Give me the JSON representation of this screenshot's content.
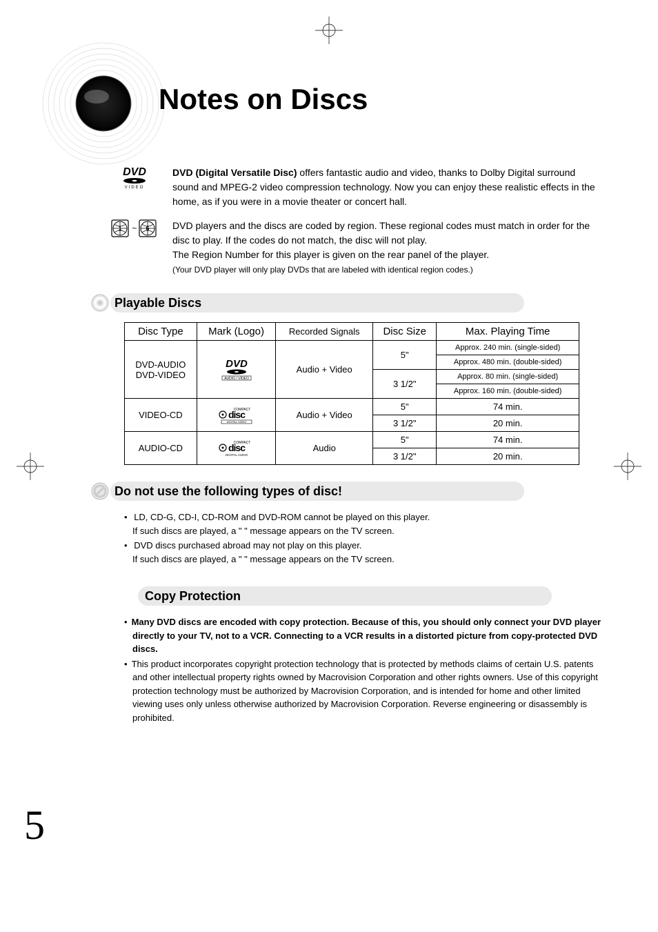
{
  "title": "Notes on Discs",
  "intro": {
    "dvd_label": "DVD (Digital Versatile Disc)",
    "dvd_text": " offers fantastic audio and video, thanks to Dolby Digital surround sound and MPEG-2 video compression technology. Now you can enjoy these realistic effects in the home, as if you were in a movie theater or concert hall.",
    "region_p1": "DVD players and the discs are coded by region. These regional codes must match in order for the disc to play. If the codes do not match, the disc will not play.",
    "region_p2": "The Region Number for this player is given on the rear panel of the player.",
    "region_note": "(Your DVD player will only play DVDs that are labeled with identical region codes.)"
  },
  "sections": {
    "playable": "Playable Discs",
    "donot": "Do not use the following types of disc!",
    "copy": "Copy Protection"
  },
  "table": {
    "headers": {
      "type": "Disc Type",
      "logo": "Mark (Logo)",
      "signals": "Recorded Signals",
      "size": "Disc Size",
      "time": "Max. Playing Time"
    },
    "dvd": {
      "type_line1": "DVD-AUDIO",
      "type_line2": "DVD-VIDEO",
      "logo_caption": "AUDIO / VIDEO",
      "signals": "Audio + Video",
      "s1": "5\"",
      "t1": "Approx. 240 min. (single-sided)",
      "t2": "Approx. 480 min. (double-sided)",
      "s2": "3 1/2\"",
      "t3": "Approx. 80 min. (single-sided)",
      "t4": "Approx. 160 min. (double-sided)"
    },
    "vcd": {
      "type": "VIDEO-CD",
      "logo_top": "COMPACT",
      "logo_mid": "disc",
      "logo_bot": "DIGITAL VIDEO",
      "signals": "Audio + Video",
      "s1": "5\"",
      "t1": "74 min.",
      "s2": "3 1/2\"",
      "t2": "20 min."
    },
    "acd": {
      "type": "AUDIO-CD",
      "logo_top": "COMPACT",
      "logo_mid": "disc",
      "logo_bot": "DIGITAL AUDIO",
      "signals": "Audio",
      "s1": "5\"",
      "t1": "74 min.",
      "s2": "3 1/2\"",
      "t2": "20 min."
    }
  },
  "donot_list": {
    "li1a": "LD, CD-G, CD-I, CD-ROM and DVD-ROM cannot be played on this player.",
    "li1b": "If such discs are played, a \"                                             \" message appears on the TV screen.",
    "li2a": "DVD discs purchased abroad may not play on this player.",
    "li2b": "If such discs are played, a \"                                             \" message appears on the TV screen."
  },
  "copy_list": {
    "li1": "Many DVD discs are encoded with copy protection. Because of this, you should only connect your DVD player directly to your TV, not to a VCR. Connecting to a VCR results in a distorted picture from copy-protected DVD discs.",
    "li2": "This product incorporates copyright protection technology that is protected by methods claims of certain U.S. patents and other intellectual property rights owned by Macrovision Corporation and other rights owners. Use of this copyright protection technology must be authorized by Macrovision Corporation, and is intended for home and other limited viewing uses only unless otherwise authorized by Macrovision Corporation. Reverse engineering or disassembly is prohibited."
  },
  "page_number": "5"
}
